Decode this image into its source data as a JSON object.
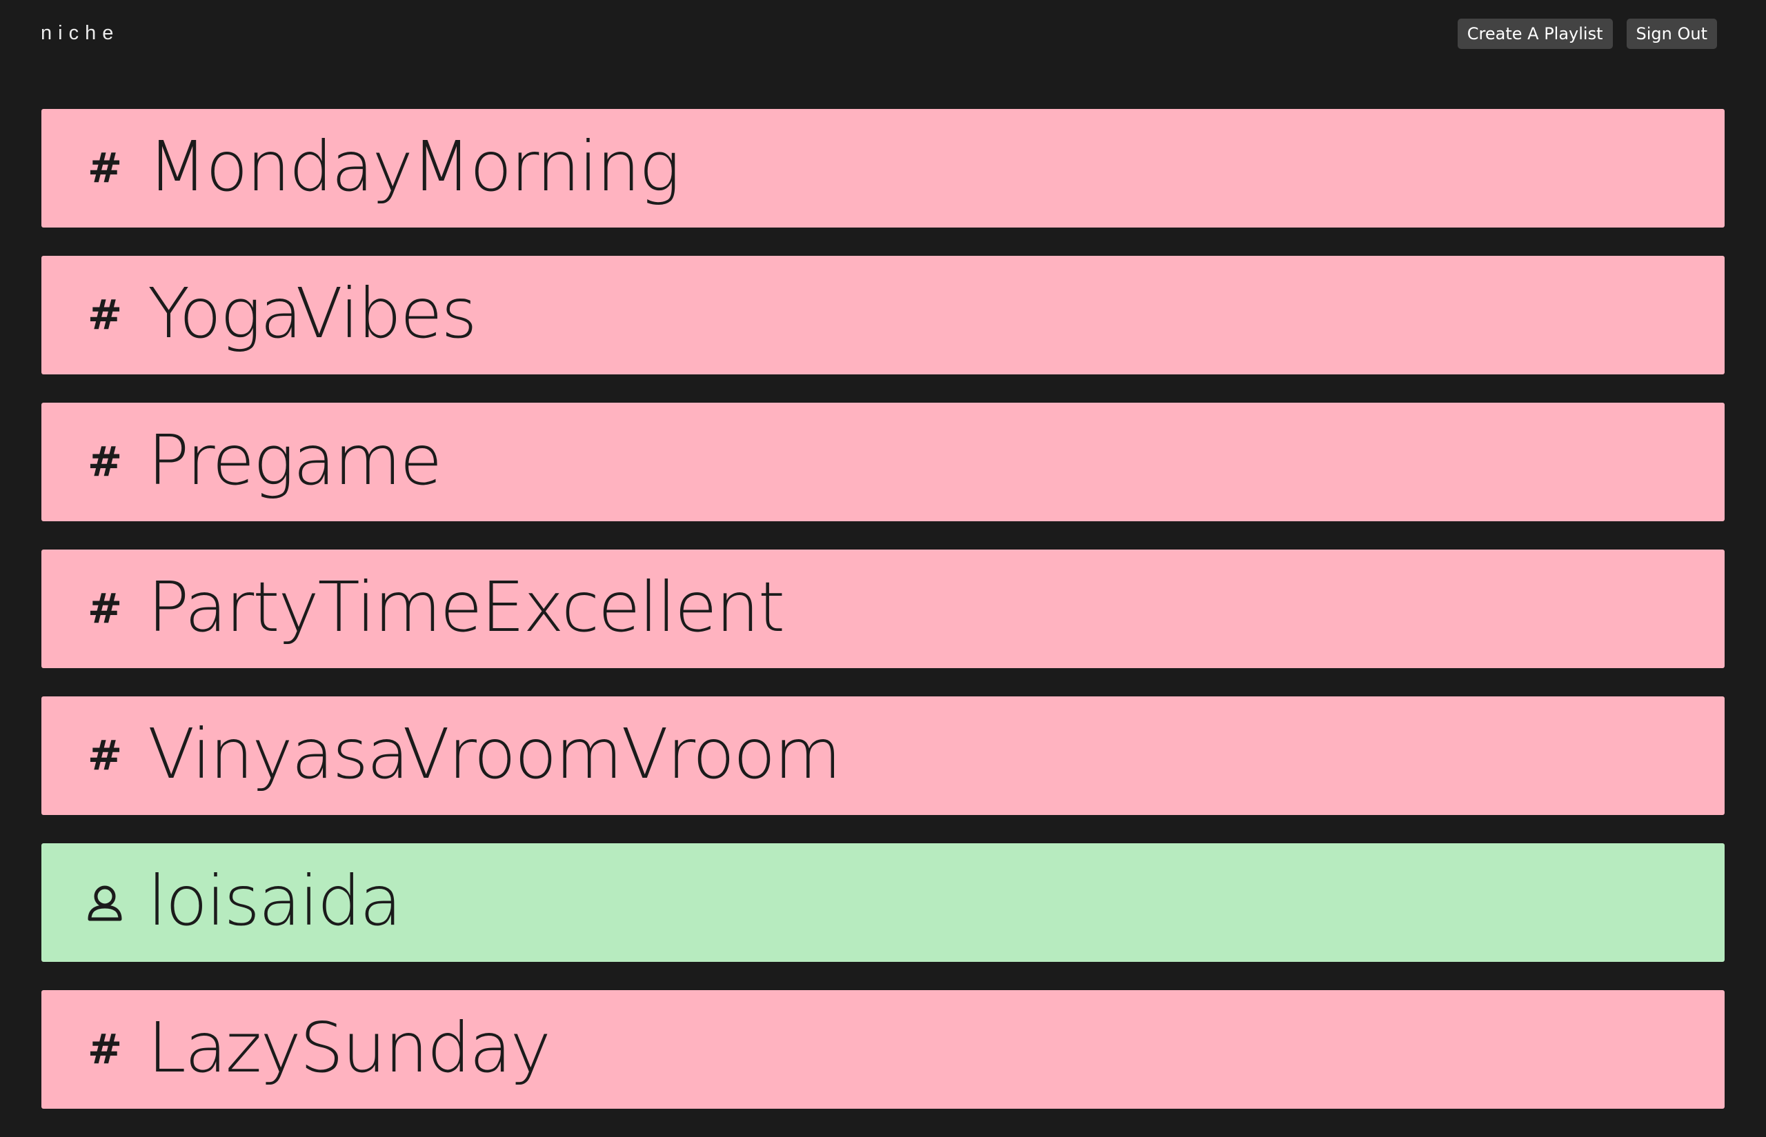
{
  "app": {
    "logo": "niche"
  },
  "nav": {
    "create_label": "Create A Playlist",
    "signout_label": "Sign Out"
  },
  "colors": {
    "background": "#1b1b1b",
    "hashtag_card": "#ffb3c0",
    "user_card": "#b7ebbf",
    "button_bg": "#434343"
  },
  "playlists": [
    {
      "type": "hashtag",
      "icon": "hash-icon",
      "symbol": "#",
      "name": "MondayMorning"
    },
    {
      "type": "hashtag",
      "icon": "hash-icon",
      "symbol": "#",
      "name": "YogaVibes"
    },
    {
      "type": "hashtag",
      "icon": "hash-icon",
      "symbol": "#",
      "name": "Pregame"
    },
    {
      "type": "hashtag",
      "icon": "hash-icon",
      "symbol": "#",
      "name": "PartyTimeExcellent"
    },
    {
      "type": "hashtag",
      "icon": "hash-icon",
      "symbol": "#",
      "name": "VinyasaVroomVroom"
    },
    {
      "type": "user",
      "icon": "user-icon",
      "symbol": "",
      "name": "loisaida"
    },
    {
      "type": "hashtag",
      "icon": "hash-icon",
      "symbol": "#",
      "name": "LazySunday"
    }
  ]
}
